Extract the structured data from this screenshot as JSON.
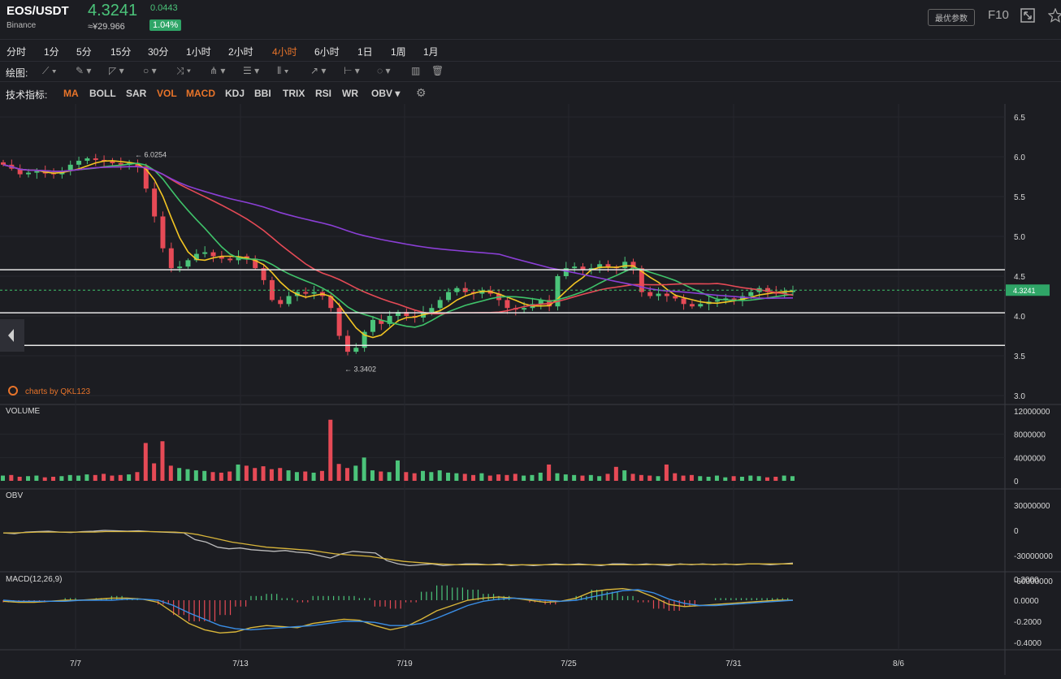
{
  "header": {
    "pair": "EOS/USDT",
    "exchange": "Binance",
    "price": "4.3241",
    "cny_price": "≈¥29.966",
    "change": "0.0443",
    "change_pct": "1.04%",
    "param_button": "最优参数",
    "f10": "F10"
  },
  "periods": [
    {
      "label": "分时",
      "active": false
    },
    {
      "label": "1分",
      "active": false
    },
    {
      "label": "5分",
      "active": false
    },
    {
      "label": "15分",
      "active": false
    },
    {
      "label": "30分",
      "active": false
    },
    {
      "label": "1小时",
      "active": false
    },
    {
      "label": "2小时",
      "active": false
    },
    {
      "label": "4小时",
      "active": true
    },
    {
      "label": "6小时",
      "active": false
    },
    {
      "label": "1日",
      "active": false
    },
    {
      "label": "1周",
      "active": false
    },
    {
      "label": "1月",
      "active": false
    }
  ],
  "drawing": {
    "label": "绘图:"
  },
  "indicators_label": "技术指标:",
  "indicators": [
    {
      "label": "MA",
      "active": true
    },
    {
      "label": "BOLL",
      "active": false
    },
    {
      "label": "SAR",
      "active": false
    },
    {
      "label": "VOL",
      "active": true
    },
    {
      "label": "MACD",
      "active": true
    },
    {
      "label": "KDJ",
      "active": false
    },
    {
      "label": "BBI",
      "active": false
    },
    {
      "label": "TRIX",
      "active": false
    },
    {
      "label": "RSI",
      "active": false
    },
    {
      "label": "WR",
      "active": false
    },
    {
      "label": "OBV ▾",
      "active": false
    }
  ],
  "watermark": "charts by QKL123",
  "colors": {
    "up": "#4bc47a",
    "down": "#e64a56",
    "accent": "#e8742a",
    "ma5": "#f3c523",
    "ma10": "#3fc36a",
    "ma20": "#e64a56",
    "ma60": "#8b3fd6"
  },
  "chart_data": [
    {
      "type": "candlestick",
      "title": "",
      "x_ticks": [
        "7/7",
        "7/13",
        "7/19",
        "7/25",
        "7/31",
        "8/6"
      ],
      "y_ticks": [
        "6.5",
        "6.0",
        "5.5",
        "5.0",
        "4.5",
        "4.0",
        "3.5",
        "3.0"
      ],
      "ylim": [
        3.0,
        6.5
      ],
      "current_price": "4.3241",
      "annotations": {
        "high": "6.0254",
        "low": "3.3402"
      },
      "horizontal_lines": [
        4.58,
        4.04,
        3.63
      ],
      "series": [
        {
          "name": "close",
          "values": [
            5.9,
            5.85,
            5.78,
            5.8,
            5.82,
            5.79,
            5.78,
            5.82,
            5.9,
            5.95,
            5.98,
            5.96,
            5.94,
            5.92,
            5.9,
            5.92,
            5.88,
            5.6,
            5.25,
            4.85,
            4.6,
            4.62,
            4.7,
            4.78,
            4.8,
            4.75,
            4.72,
            4.7,
            4.75,
            4.72,
            4.6,
            4.45,
            4.2,
            4.15,
            4.25,
            4.3,
            4.28,
            4.3,
            4.25,
            4.1,
            3.75,
            3.55,
            3.6,
            3.8,
            3.95,
            3.9,
            4.0,
            4.05,
            4.0,
            3.98,
            4.05,
            4.1,
            4.2,
            4.3,
            4.35,
            4.3,
            4.28,
            4.32,
            4.28,
            4.2,
            4.1,
            4.08,
            4.1,
            4.15,
            4.2,
            4.12,
            4.5,
            4.6,
            4.62,
            4.58,
            4.6,
            4.65,
            4.62,
            4.6,
            4.68,
            4.6,
            4.3,
            4.25,
            4.28,
            4.25,
            4.22,
            4.15,
            4.12,
            4.15,
            4.18,
            4.2,
            4.22,
            4.2,
            4.25,
            4.3,
            4.35,
            4.3,
            4.28,
            4.3,
            4.32
          ]
        }
      ]
    },
    {
      "type": "bar",
      "title": "VOLUME",
      "y_ticks": [
        "12000000",
        "8000000",
        "4000000",
        "0"
      ],
      "ylim": [
        0,
        12000000
      ],
      "values": [
        900000,
        1000000,
        700000,
        800000,
        900000,
        600000,
        700000,
        800000,
        1000000,
        900000,
        1100000,
        1000000,
        1200000,
        900000,
        1000000,
        1100000,
        1500000,
        6500000,
        3000000,
        6800000,
        2600000,
        2200000,
        2000000,
        1800000,
        1700000,
        1500000,
        1400000,
        1600000,
        2800000,
        2600000,
        2200000,
        2500000,
        2000000,
        2200000,
        1800000,
        1500000,
        1600000,
        1400000,
        1700000,
        10500000,
        2900000,
        2200000,
        2600000,
        4000000,
        1800000,
        1600000,
        1500000,
        3500000,
        1500000,
        1300000,
        1700000,
        1500000,
        1800000,
        1400000,
        1300000,
        1200000,
        1000000,
        1300000,
        900000,
        1100000,
        1000000,
        1200000,
        900000,
        1000000,
        1400000,
        2800000,
        1300000,
        1100000,
        1000000,
        900000,
        1000000,
        800000,
        1200000,
        2400000,
        1800000,
        1200000,
        1000000,
        900000,
        800000,
        2800000,
        1300000,
        900000,
        1000000,
        800000,
        700000,
        900000,
        600000,
        800000,
        700000,
        900000,
        800000,
        600000,
        700000,
        900000,
        800000
      ]
    },
    {
      "type": "line",
      "title": "OBV",
      "y_ticks": [
        "30000000",
        "0",
        "-30000000",
        "-60000000"
      ],
      "ylim": [
        -60000000,
        30000000
      ],
      "series": [
        {
          "name": "obv",
          "values": [
            -3000000,
            -4000000,
            -2000000,
            -1500000,
            -1000000,
            -2000000,
            -2500000,
            -1500000,
            -1000000,
            0,
            -500000,
            -1000000,
            -500000,
            -1500000,
            -2000000,
            -2500000,
            -3000000,
            -11000000,
            -14000000,
            -20000000,
            -22000000,
            -21000000,
            -23000000,
            -24000000,
            -25000000,
            -24000000,
            -26000000,
            -27000000,
            -30000000,
            -33000000,
            -28000000,
            -25000000,
            -26000000,
            -27000000,
            -36000000,
            -40000000,
            -42000000,
            -41000000,
            -40000000,
            -42000000,
            -41000000,
            -40000000,
            -40000000,
            -41000000,
            -40000000,
            -42000000,
            -41000000,
            -42000000,
            -41000000,
            -40000000,
            -41000000,
            -40000000,
            -41000000,
            -42000000,
            -40000000,
            -40000000,
            -41000000,
            -40000000,
            -41000000,
            -42000000,
            -40000000,
            -41000000,
            -40000000,
            -41000000,
            -40000000,
            -41000000,
            -40000000,
            -40000000,
            -41000000,
            -40000000,
            -39000000
          ]
        },
        {
          "name": "maobv",
          "values": [
            -3000000,
            -3000000,
            -2500000,
            -2000000,
            -2000000,
            -2000000,
            -2000000,
            -2000000,
            -2000000,
            -1500000,
            -1500000,
            -1500000,
            -1500000,
            -1500000,
            -1800000,
            -2000000,
            -3000000,
            -5000000,
            -8000000,
            -11000000,
            -14000000,
            -16000000,
            -18000000,
            -20000000,
            -21000000,
            -22000000,
            -23000000,
            -24000000,
            -26000000,
            -28000000,
            -29000000,
            -30000000,
            -31000000,
            -33000000,
            -35000000,
            -37000000,
            -38000000,
            -39000000,
            -40000000,
            -40500000,
            -41000000,
            -41000000,
            -41000000,
            -41000000,
            -41000000,
            -41000000,
            -41000000,
            -41000000,
            -41000000,
            -41000000,
            -41000000,
            -41000000,
            -41000000,
            -41000000,
            -41000000,
            -41000000,
            -41000000,
            -40500000,
            -40500000,
            -40500000,
            -40500000,
            -40500000,
            -40500000,
            -40500000,
            -40500000,
            -40000000,
            -40000000,
            -40000000,
            -40000000,
            -40000000
          ]
        }
      ]
    },
    {
      "type": "line",
      "title": "MACD(12,26,9)",
      "y_ticks": [
        "0.2000",
        "0.0000",
        "-0.2000",
        "-0.4000"
      ],
      "ylim": [
        -0.4,
        0.2
      ],
      "series": [
        {
          "name": "dif",
          "values": [
            -0.01,
            -0.02,
            -0.02,
            -0.01,
            0,
            0,
            0.01,
            0.02,
            0.02,
            0.01,
            -0.02,
            -0.12,
            -0.22,
            -0.28,
            -0.31,
            -0.3,
            -0.26,
            -0.24,
            -0.25,
            -0.26,
            -0.22,
            -0.2,
            -0.18,
            -0.19,
            -0.24,
            -0.28,
            -0.25,
            -0.18,
            -0.1,
            -0.05,
            0,
            0.02,
            0.03,
            0.02,
            0,
            -0.02,
            -0.01,
            0.02,
            0.08,
            0.1,
            0.11,
            0.09,
            0.03,
            -0.04,
            -0.06,
            -0.05,
            -0.04,
            -0.03,
            -0.02,
            -0.01,
            0,
            0
          ]
        },
        {
          "name": "dea",
          "values": [
            0,
            -0.01,
            -0.01,
            -0.01,
            -0.01,
            0,
            0,
            0,
            0.01,
            0.01,
            0,
            -0.05,
            -0.12,
            -0.18,
            -0.24,
            -0.27,
            -0.28,
            -0.27,
            -0.26,
            -0.25,
            -0.24,
            -0.22,
            -0.2,
            -0.2,
            -0.21,
            -0.24,
            -0.24,
            -0.22,
            -0.17,
            -0.11,
            -0.05,
            -0.01,
            0.01,
            0.02,
            0.01,
            0,
            -0.01,
            0,
            0.03,
            0.06,
            0.09,
            0.1,
            0.07,
            0.01,
            -0.03,
            -0.05,
            -0.05,
            -0.04,
            -0.03,
            -0.02,
            -0.01,
            0
          ]
        }
      ]
    }
  ]
}
